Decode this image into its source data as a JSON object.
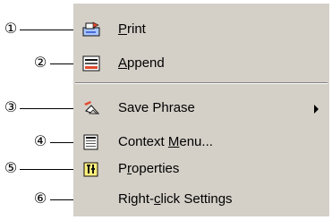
{
  "callouts": [
    "①",
    "②",
    "③",
    "④",
    "⑤",
    "⑥"
  ],
  "menu": {
    "items": [
      {
        "pre": "",
        "accel": "P",
        "post": "rint",
        "submenu": false
      },
      {
        "pre": "",
        "accel": "A",
        "post": "ppend",
        "submenu": false
      },
      {
        "pre": "Save Phrase",
        "accel": "",
        "post": "",
        "submenu": true
      },
      {
        "pre": "Context ",
        "accel": "M",
        "post": "enu...",
        "submenu": false
      },
      {
        "pre": "P",
        "accel": "r",
        "post": "operties",
        "submenu": false
      },
      {
        "pre": "Right-",
        "accel": "c",
        "post": "lick Settings",
        "submenu": false
      }
    ],
    "icons": [
      "print-icon",
      "append-icon",
      "save-phrase-icon",
      "context-menu-icon",
      "properties-icon"
    ]
  }
}
